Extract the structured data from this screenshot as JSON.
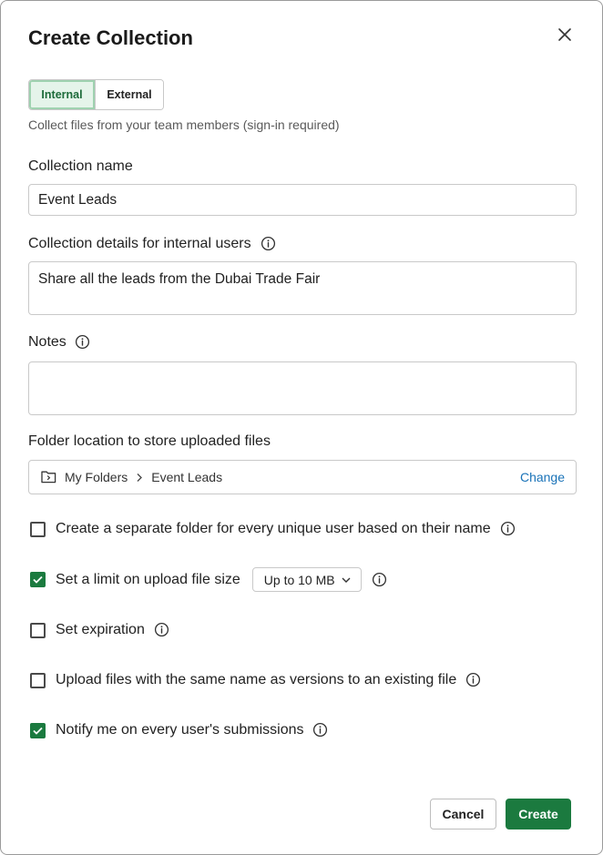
{
  "dialog": {
    "title": "Create Collection",
    "close_icon": "close-icon"
  },
  "mode": {
    "options": [
      "Internal",
      "External"
    ],
    "selected": "Internal",
    "hint": "Collect files from your team members (sign-in required)"
  },
  "fields": {
    "name_label": "Collection name",
    "name_value": "Event Leads",
    "details_label": "Collection details for internal users",
    "details_value": "Share all the leads from the Dubai Trade Fair",
    "notes_label": "Notes",
    "notes_value": "",
    "folder_label": "Folder location to store uploaded files",
    "folder_path": [
      "My Folders",
      "Event Leads"
    ],
    "folder_change": "Change"
  },
  "options": [
    {
      "label": "Create a separate folder for every unique user based on their name",
      "checked": false
    },
    {
      "label": "Set a limit on upload file size",
      "checked": true,
      "select_value": "Up to 10 MB"
    },
    {
      "label": "Set expiration",
      "checked": false
    },
    {
      "label": "Upload files with the same name as versions to an existing file",
      "checked": false
    },
    {
      "label": "Notify me on every user's submissions",
      "checked": true
    }
  ],
  "footer": {
    "cancel_label": "Cancel",
    "create_label": "Create"
  },
  "colors": {
    "primary": "#1b7a3f",
    "selected_tab_bg": "#e5f4ea",
    "link": "#1a73b8"
  }
}
